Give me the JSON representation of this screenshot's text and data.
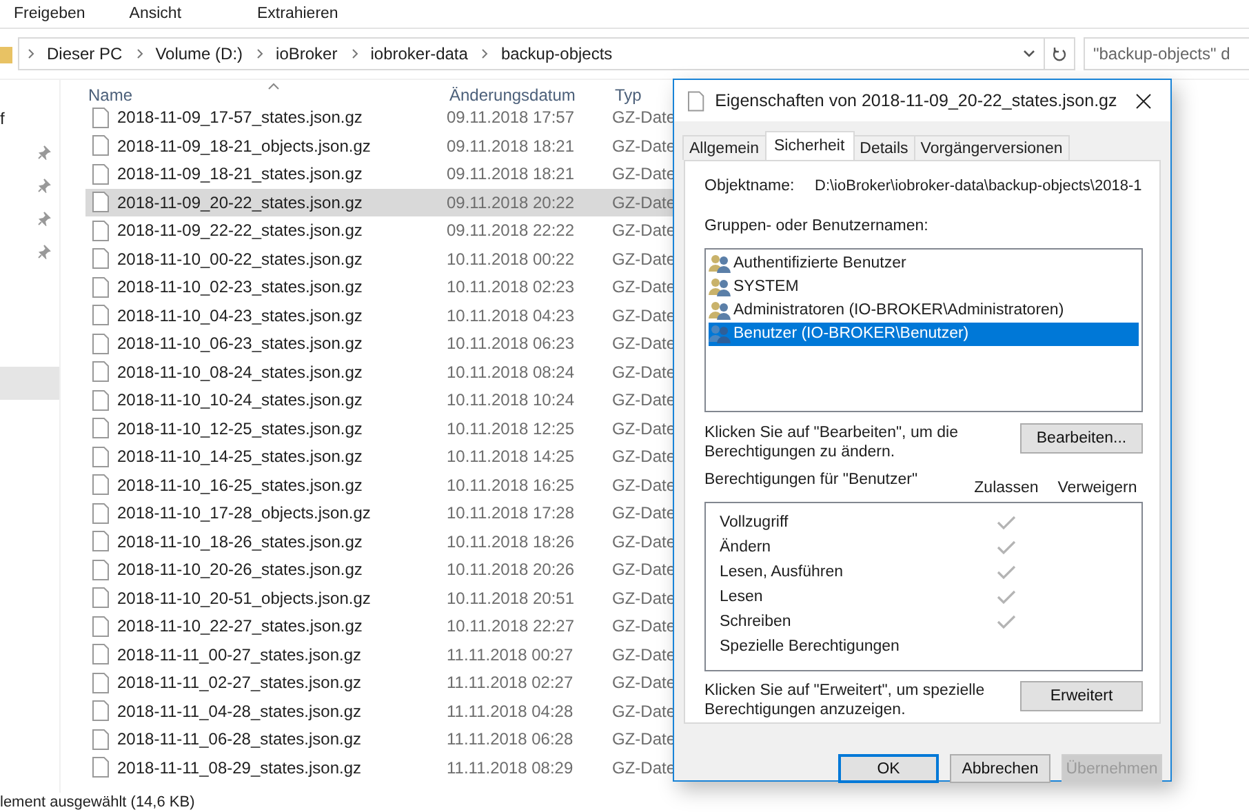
{
  "ribbon_tabs": [
    {
      "label": "Freigeben"
    },
    {
      "label": "Ansicht"
    },
    {
      "label": "Extrahieren"
    }
  ],
  "breadcrumb": [
    "Dieser PC",
    "Volume (D:)",
    "ioBroker",
    "iobroker-data",
    "backup-objects"
  ],
  "search": {
    "placeholder": "\"backup-objects\" d"
  },
  "nav_items": [
    {
      "label": "f",
      "pinned": false,
      "selected": false
    },
    {
      "pinned": true,
      "selected": false
    },
    {
      "pinned": true,
      "selected": false
    },
    {
      "pinned": true,
      "selected": false
    },
    {
      "pinned": true,
      "selected": false
    },
    {
      "pinned": false,
      "selected": true
    }
  ],
  "file_list": {
    "columns": [
      "Name",
      "Änderungsdatum",
      "Typ"
    ],
    "rows": [
      {
        "name": "2018-11-09_17-57_states.json.gz",
        "date": "09.11.2018 17:57",
        "type": "GZ-Date",
        "selected": false
      },
      {
        "name": "2018-11-09_18-21_objects.json.gz",
        "date": "09.11.2018 18:21",
        "type": "GZ-Date",
        "selected": false
      },
      {
        "name": "2018-11-09_18-21_states.json.gz",
        "date": "09.11.2018 18:21",
        "type": "GZ-Date",
        "selected": false
      },
      {
        "name": "2018-11-09_20-22_states.json.gz",
        "date": "09.11.2018 20:22",
        "type": "GZ-Date",
        "selected": true
      },
      {
        "name": "2018-11-09_22-22_states.json.gz",
        "date": "09.11.2018 22:22",
        "type": "GZ-Date",
        "selected": false
      },
      {
        "name": "2018-11-10_00-22_states.json.gz",
        "date": "10.11.2018 00:22",
        "type": "GZ-Date",
        "selected": false
      },
      {
        "name": "2018-11-10_02-23_states.json.gz",
        "date": "10.11.2018 02:23",
        "type": "GZ-Date",
        "selected": false
      },
      {
        "name": "2018-11-10_04-23_states.json.gz",
        "date": "10.11.2018 04:23",
        "type": "GZ-Date",
        "selected": false
      },
      {
        "name": "2018-11-10_06-23_states.json.gz",
        "date": "10.11.2018 06:23",
        "type": "GZ-Date",
        "selected": false
      },
      {
        "name": "2018-11-10_08-24_states.json.gz",
        "date": "10.11.2018 08:24",
        "type": "GZ-Date",
        "selected": false
      },
      {
        "name": "2018-11-10_10-24_states.json.gz",
        "date": "10.11.2018 10:24",
        "type": "GZ-Date",
        "selected": false
      },
      {
        "name": "2018-11-10_12-25_states.json.gz",
        "date": "10.11.2018 12:25",
        "type": "GZ-Date",
        "selected": false
      },
      {
        "name": "2018-11-10_14-25_states.json.gz",
        "date": "10.11.2018 14:25",
        "type": "GZ-Date",
        "selected": false
      },
      {
        "name": "2018-11-10_16-25_states.json.gz",
        "date": "10.11.2018 16:25",
        "type": "GZ-Date",
        "selected": false
      },
      {
        "name": "2018-11-10_17-28_objects.json.gz",
        "date": "10.11.2018 17:28",
        "type": "GZ-Date",
        "selected": false
      },
      {
        "name": "2018-11-10_18-26_states.json.gz",
        "date": "10.11.2018 18:26",
        "type": "GZ-Date",
        "selected": false
      },
      {
        "name": "2018-11-10_20-26_states.json.gz",
        "date": "10.11.2018 20:26",
        "type": "GZ-Date",
        "selected": false
      },
      {
        "name": "2018-11-10_20-51_objects.json.gz",
        "date": "10.11.2018 20:51",
        "type": "GZ-Date",
        "selected": false
      },
      {
        "name": "2018-11-10_22-27_states.json.gz",
        "date": "10.11.2018 22:27",
        "type": "GZ-Date",
        "selected": false
      },
      {
        "name": "2018-11-11_00-27_states.json.gz",
        "date": "11.11.2018 00:27",
        "type": "GZ-Date",
        "selected": false
      },
      {
        "name": "2018-11-11_02-27_states.json.gz",
        "date": "11.11.2018 02:27",
        "type": "GZ-Date",
        "selected": false
      },
      {
        "name": "2018-11-11_04-28_states.json.gz",
        "date": "11.11.2018 04:28",
        "type": "GZ-Date",
        "selected": false
      },
      {
        "name": "2018-11-11_06-28_states.json.gz",
        "date": "11.11.2018 06:28",
        "type": "GZ-Date",
        "selected": false
      },
      {
        "name": "2018-11-11_08-29_states.json.gz",
        "date": "11.11.2018 08:29",
        "type": "GZ-Date",
        "selected": false
      }
    ]
  },
  "status_bar": "lement ausgewählt (14,6 KB)",
  "dialog": {
    "title": "Eigenschaften von 2018-11-09_20-22_states.json.gz",
    "tabs": [
      {
        "label": "Allgemein",
        "selected": false
      },
      {
        "label": "Sicherheit",
        "selected": true
      },
      {
        "label": "Details",
        "selected": false
      },
      {
        "label": "Vorgängerversionen",
        "selected": false
      }
    ],
    "object_label": "Objektname:",
    "object_value": "D:\\ioBroker\\iobroker-data\\backup-objects\\2018-1",
    "groups_label": "Gruppen- oder Benutzernamen:",
    "groups": [
      {
        "label": "Authentifizierte Benutzer",
        "selected": false
      },
      {
        "label": "SYSTEM",
        "selected": false
      },
      {
        "label": "Administratoren (IO-BROKER\\Administratoren)",
        "selected": false
      },
      {
        "label": "Benutzer (IO-BROKER\\Benutzer)",
        "selected": true
      }
    ],
    "edit_hint": "Klicken Sie auf \"Bearbeiten\", um die Berechtigungen zu ändern.",
    "edit_button": "Bearbeiten...",
    "permissions_label": "Berechtigungen für \"Benutzer\"",
    "permission_columns": [
      "Zulassen",
      "Verweigern"
    ],
    "permissions": [
      {
        "label": "Vollzugriff",
        "allow": true,
        "deny": false
      },
      {
        "label": "Ändern",
        "allow": true,
        "deny": false
      },
      {
        "label": "Lesen, Ausführen",
        "allow": true,
        "deny": false
      },
      {
        "label": "Lesen",
        "allow": true,
        "deny": false
      },
      {
        "label": "Schreiben",
        "allow": true,
        "deny": false
      },
      {
        "label": "Spezielle Berechtigungen",
        "allow": false,
        "deny": false
      }
    ],
    "advanced_hint": "Klicken Sie auf \"Erweitert\", um spezielle Berechtigungen anzuzeigen.",
    "advanced_button": "Erweitert",
    "buttons": [
      {
        "label": "OK",
        "default": true,
        "disabled": false
      },
      {
        "label": "Abbrechen",
        "default": false,
        "disabled": false
      },
      {
        "label": "Übernehmen",
        "default": false,
        "disabled": true
      }
    ]
  }
}
